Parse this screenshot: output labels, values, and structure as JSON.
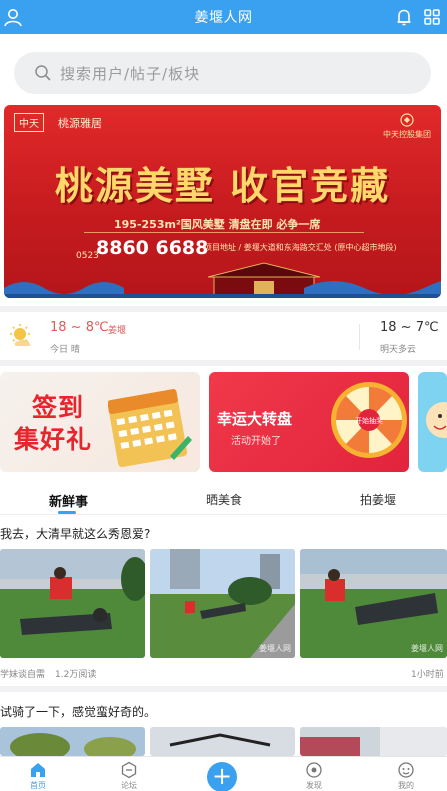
{
  "header": {
    "title": "姜堰人网",
    "icons": [
      "user-icon",
      "bell-icon",
      "grid-icon"
    ]
  },
  "search": {
    "placeholder": "搜索用户/帖子/板块"
  },
  "banner": {
    "brand": "中天",
    "brand_name": "桃源雅居",
    "corner_text": "中天控股集团",
    "slogan": "桃源美墅 收官竞藏",
    "subtitle": "195-253m²国风美墅 清盘在即 必争一席",
    "phone_prefix": "0523",
    "phone": "8860 6688",
    "address": "项目地址 / 姜堰大道和东海路交汇处 (原中心超市地段)"
  },
  "weather": {
    "today_temp": "18 ~ 8℃",
    "city": "姜堰",
    "today_desc": "今日 晴",
    "tomorrow_temp": "18 ~ 7℃",
    "tomorrow_desc": "明天多云"
  },
  "promos": [
    {
      "line1": "签到",
      "line2": "集好礼"
    },
    {
      "title": "幸运大转盘",
      "subtitle": "活动开始了",
      "wheel_center": "开始抽奖"
    }
  ],
  "tabs": [
    "新鲜事",
    "晒美食",
    "拍姜堰"
  ],
  "posts": [
    {
      "title": "我去，大清早就这么秀恩爱?",
      "watermark": "姜堰人网",
      "author": "学妹谈自需",
      "views": "1.2万阅读",
      "time": "1小时前"
    },
    {
      "title": "试骑了一下，感觉蛮好奇的。"
    }
  ],
  "bottom_nav": [
    {
      "label": "首页",
      "icon": "home-icon"
    },
    {
      "label": "论坛",
      "icon": "forum-icon"
    },
    {
      "label": "发现",
      "icon": "discover-icon"
    },
    {
      "label": "我的",
      "icon": "profile-icon"
    }
  ],
  "post_button": "+",
  "colors": {
    "primary": "#3aa0f0",
    "banner_red": "#d62027",
    "temp_red": "#e05a5a"
  }
}
